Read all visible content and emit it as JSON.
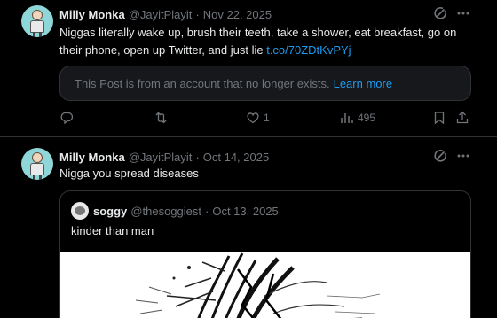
{
  "tweets": [
    {
      "author_name": "Milly Monka",
      "handle": "@JayitPlayit",
      "dot": "·",
      "date": "Nov 22, 2025",
      "text_plain": "Niggas literally wake up, brush their teeth, take a shower, eat breakfast, go on their phone, open up Twitter, and just lie ",
      "text_link": "t.co/70ZDtKvPYj",
      "notice_text": "This Post is from an account that no longer exists.",
      "notice_link": "Learn more",
      "likes": "1",
      "views": "495"
    },
    {
      "author_name": "Milly Monka",
      "handle": "@JayitPlayit",
      "dot": "·",
      "date": "Oct 14, 2025",
      "text": "Nigga you spread diseases",
      "quote": {
        "author_name": "soggy",
        "handle": "@thesoggiest",
        "dot": "·",
        "date": "Oct 13, 2025",
        "text": "kinder than man"
      }
    }
  ],
  "icons": [
    "grok-icon",
    "more-icon",
    "reply-icon",
    "retweet-icon",
    "like-icon",
    "views-icon",
    "bookmark-icon",
    "share-icon"
  ],
  "colors": {
    "background": "#000000",
    "text": "#e7e9ea",
    "muted": "#71767b",
    "link": "#1d9bf0",
    "border": "#2f3336"
  }
}
